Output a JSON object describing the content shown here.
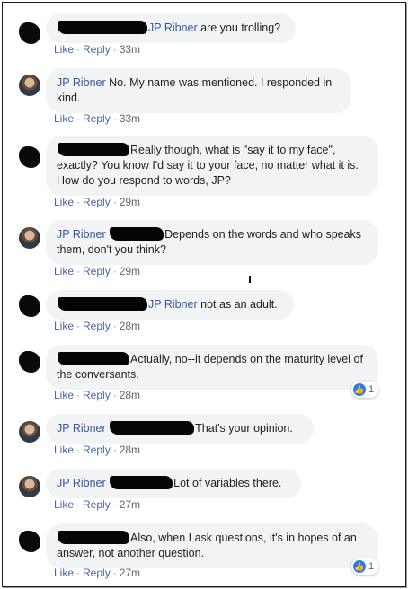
{
  "comments": [
    {
      "avatar": "redacted",
      "author": "JP Ribner",
      "text": "are you trolling?",
      "like": "Like",
      "reply": "Reply",
      "time": "33m"
    },
    {
      "avatar": "photo",
      "author": "JP Ribner",
      "text": "No. My name was mentioned. I responded in kind.",
      "like": "Like",
      "reply": "Reply",
      "time": "33m"
    },
    {
      "avatar": "redacted",
      "text": "Really though, what is \"say it to my face\", exactly? You know I'd say it to your face, no matter what it is. How do you respond to words, JP?",
      "like": "Like",
      "reply": "Reply",
      "time": "29m"
    },
    {
      "avatar": "photo",
      "author": "JP Ribner",
      "text": "Depends on the words and who speaks them, don't you think?",
      "like": "Like",
      "reply": "Reply",
      "time": "29m"
    },
    {
      "avatar": "redacted",
      "author": "JP Ribner",
      "text": "not as an adult.",
      "like": "Like",
      "reply": "Reply",
      "time": "28m"
    },
    {
      "avatar": "redacted",
      "text": "Actually, no--it depends on the maturity level of the conversants.",
      "like": "Like",
      "reply": "Reply",
      "time": "28m",
      "reaction_count": "1"
    },
    {
      "avatar": "photo",
      "author": "JP Ribner",
      "text": "That's your opinion.",
      "like": "Like",
      "reply": "Reply",
      "time": "28m"
    },
    {
      "avatar": "photo",
      "author": "JP Ribner",
      "text": "Lot of variables there.",
      "like": "Like",
      "reply": "Reply",
      "time": "27m"
    },
    {
      "avatar": "redacted",
      "text": "Also, when I ask questions, it's in hopes of an answer, not another question.",
      "like": "Like",
      "reply": "Reply",
      "time": "27m",
      "reaction_count": "1"
    }
  ],
  "separator": "·",
  "colors": {
    "link": "#385898",
    "bubble": "#f2f3f5",
    "like_blue": "#2b7bf0"
  }
}
